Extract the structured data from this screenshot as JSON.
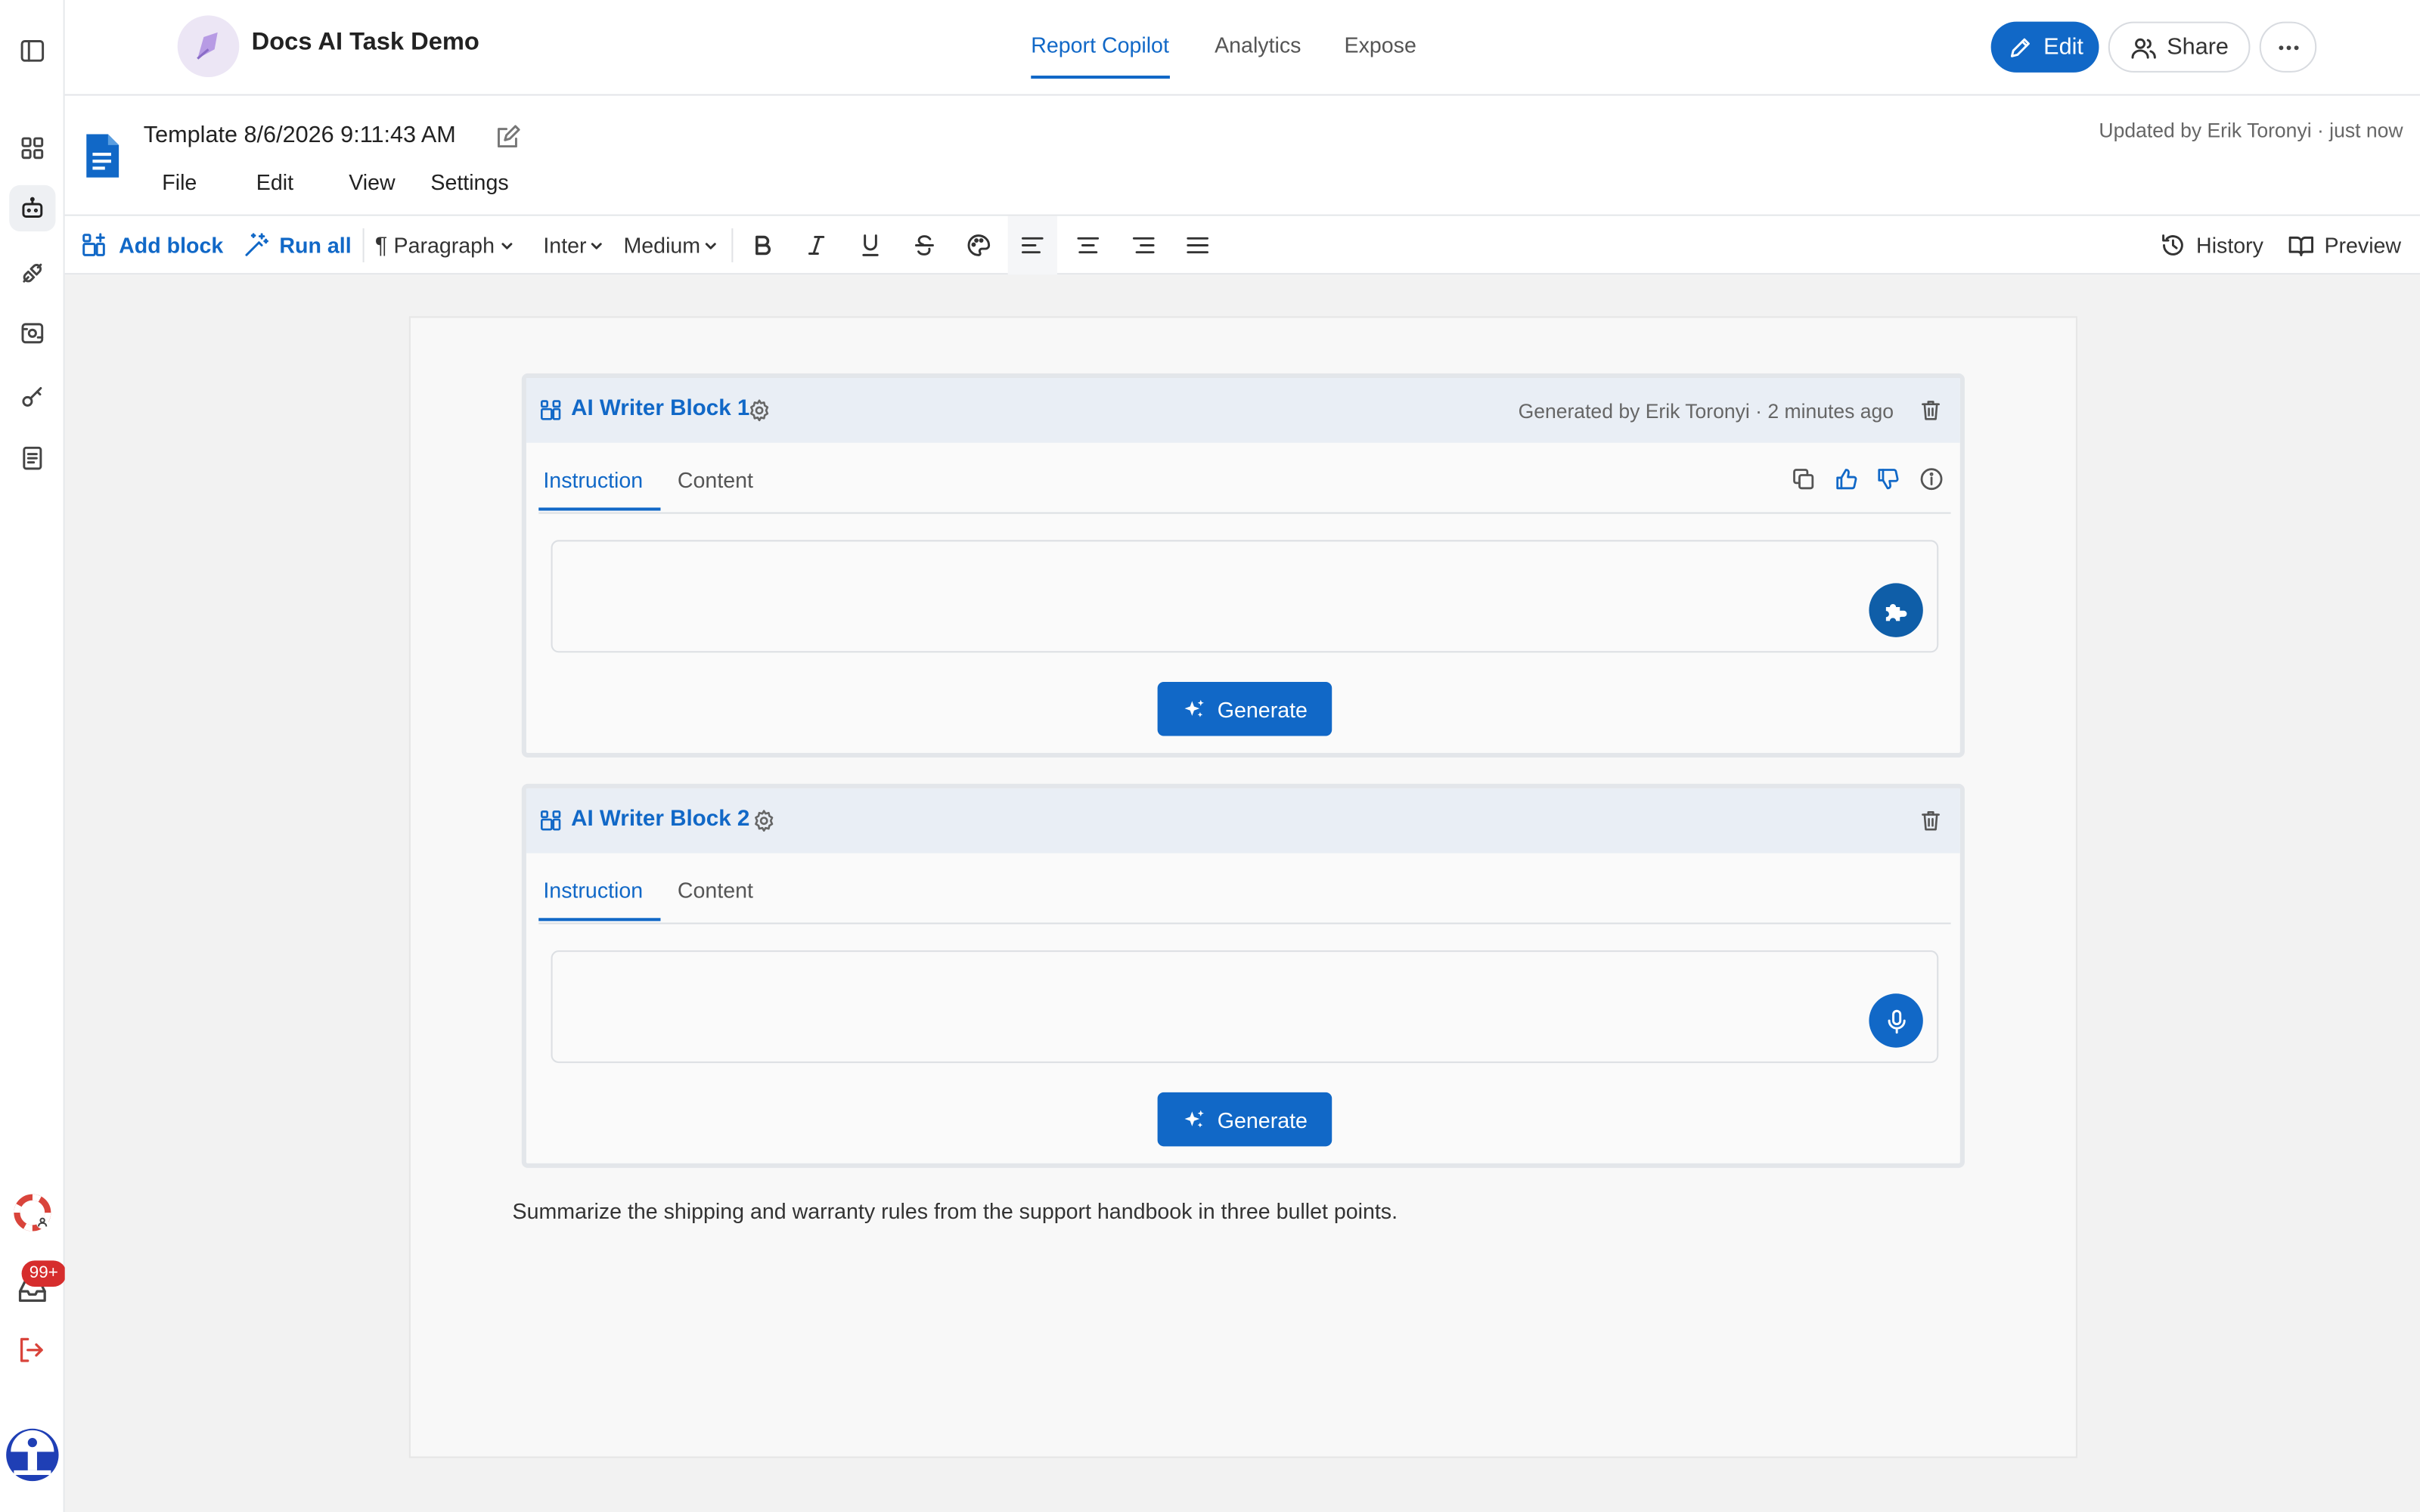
{
  "header": {
    "app_name": "Docs AI Task Demo",
    "tabs": [
      {
        "label": "Report Copilot",
        "active": true
      },
      {
        "label": "Analytics",
        "active": false
      },
      {
        "label": "Expose",
        "active": false
      }
    ],
    "edit_label": "Edit",
    "share_label": "Share",
    "more_icon": "more-horizontal-icon"
  },
  "document": {
    "title": "Template 8/6/2026 9:11:43 AM",
    "updated": "Updated by Erik Toronyi · just now",
    "menus": [
      "File",
      "Edit",
      "View",
      "Settings"
    ]
  },
  "toolbar": {
    "add_block": "Add block",
    "run_all": "Run all",
    "paragraph": "Paragraph",
    "font": "Inter",
    "weight": "Medium",
    "history": "History",
    "preview": "Preview"
  },
  "blocks": [
    {
      "title": "AI Writer Block 1",
      "meta": "Generated by Erik Toronyi · 2 minutes ago",
      "tabs": [
        "Instruction",
        "Content"
      ],
      "input_value": "",
      "action_icon": "plugin-icon",
      "generate_label": "Generate"
    },
    {
      "title": "AI Writer Block 2",
      "meta": "",
      "tabs": [
        "Instruction",
        "Content"
      ],
      "input_value": "",
      "action_icon": "microphone-icon",
      "generate_label": "Generate"
    }
  ],
  "summary_text": "Summarize the shipping and warranty rules from the support handbook in three bullet points.",
  "rail": {
    "badge": "99+"
  },
  "colors": {
    "accent": "#1168c7",
    "accent_dark": "#0f5ea8",
    "badge": "#d62d2d",
    "logout": "#d9443b"
  }
}
